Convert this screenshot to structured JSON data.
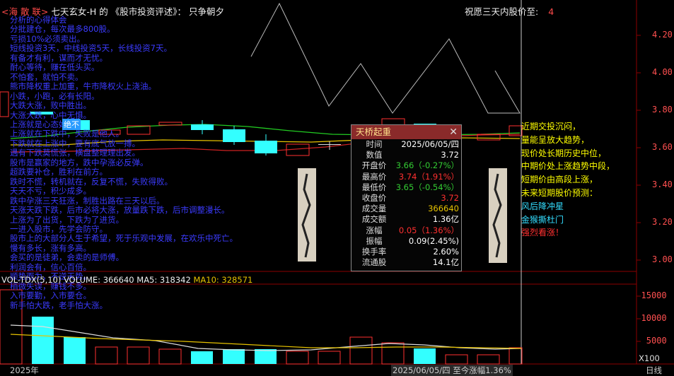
{
  "header": {
    "part1": "<海 散 联>",
    "part2": "七天玄女-H 的 《股市投资评述》： 只争朝夕"
  },
  "goal": {
    "label": "祝愿三天内股价至:",
    "value": "4"
  },
  "price_axis": [
    "4.20",
    "4.00",
    "3.80",
    "3.60",
    "3.40",
    "3.20",
    "3.00"
  ],
  "volume_axis": [
    "15000",
    "10000",
    "5000"
  ],
  "volume_unit": "X100",
  "bottom": {
    "year": "2025年",
    "date_info": "2025/06/05/四 至今涨幅1.36%",
    "period": "日线"
  },
  "volume_header": {
    "title": "VOL-TDX(5,10)",
    "volume": "VOLUME: 366640",
    "ma5": "MA5: 318342",
    "ma10": "MA10: 328571"
  },
  "blue_badge": "绝不",
  "blue_text_lines": [
    "分析的心得体会",
    "分批建仓，每次最多800股。",
    "亏损10%必须卖出。",
    "短线投资3天，中线投资5天，长线投资7天。",
    "有备才有利，谋而才无忧。",
    "耐心等待，赚在低头买。",
    "不怕套，就怕不卖。",
    "熊市降权重上加重，牛市降权火上浇油。",
    "小跌，小跑，必有长阳。",
    "大跌大涨，败中胜出。",
    "大涨大跌，心中无惧。",
    "上涨就是心态好。",
    "上涨就在下跌中，失败是他人。",
    "下跌就在上涨中，要有底气放一搏。",
    "遇有下跌莫慌张，横盘整理理出发。",
    "股市是赢家的地方，跌中孕涨必反弹。",
    "超跌要补仓，胜利在前方。",
    "跌时不慌，转机就在，反复不慌，失败得败。",
    "天天不亏，积少成多。",
    "跌中孕涨三天狂涨，制胜出路在三天以后。",
    "天涨天跌下跌，后市必将大涨，放量跌下跌，后市调整漫长。",
    "上涨为了出货，下跌为了进货。",
    "一进入股市，先学会防守。",
    "股市上的大部分人生于希望，死于乐观中发展，在欢乐中死亡。",
    "慢有多长，涨有多高。",
    "会买的是徒弟，会卖的是师傅。",
    "利润会有，信心百倍。",
    "顺势而为，不逆天势。",
    "稍微失误，赚钱不多。",
    "入市要勤，入市要仓。",
    "新手怕大跌，老手怕大涨。"
  ],
  "right_notes": [
    {
      "text": "近期交投沉闷，",
      "color": "#ffff00"
    },
    {
      "text": "量能呈放大趋势，",
      "color": "#ffff00"
    },
    {
      "text": "现价处长期历史中位，",
      "color": "#ffff00"
    },
    {
      "text": "中期价处上涨趋势中段，",
      "color": "#ffff00"
    },
    {
      "text": "短期价由高段上涨，",
      "color": "#ffff00"
    },
    {
      "text": "未来短期股价预测：",
      "color": "#ffff00"
    },
    {
      "text": "风后降冲星",
      "color": "#33ddff"
    },
    {
      "text": "金猴撕杜门",
      "color": "#33ddff"
    },
    {
      "text": "强烈看涨！",
      "color": "#ff3030"
    }
  ],
  "popup": {
    "title": "天桥起重",
    "close": "✕",
    "rows": [
      {
        "label": "时间",
        "value": "2025/06/05/四",
        "color": "#ffffff"
      },
      {
        "label": "数值",
        "value": "3.72",
        "color": "#ffffff"
      },
      {
        "label": "开盘价",
        "value": "3.66（-0.27%）",
        "color": "#33cc33"
      },
      {
        "label": "最高价",
        "value": "3.74（1.91%）",
        "color": "#ff3030"
      },
      {
        "label": "最低价",
        "value": "3.65（-0.54%）",
        "color": "#33cc33"
      },
      {
        "label": "收盘价",
        "value": "3.72",
        "color": "#ff3030"
      },
      {
        "label": "成交量",
        "value": "366640",
        "color": "#e6c200"
      },
      {
        "label": "成交额",
        "value": "1.36亿",
        "color": "#ffffff"
      },
      {
        "label": "涨幅",
        "value": "0.05（1.36%）",
        "color": "#ff3030"
      },
      {
        "label": "振幅",
        "value": "0.09(2.45%)",
        "color": "#ffffff"
      },
      {
        "label": "换手率",
        "value": "2.60%",
        "color": "#ffffff"
      },
      {
        "label": "流通股",
        "value": "14.1亿",
        "color": "#ffffff"
      }
    ]
  }
}
